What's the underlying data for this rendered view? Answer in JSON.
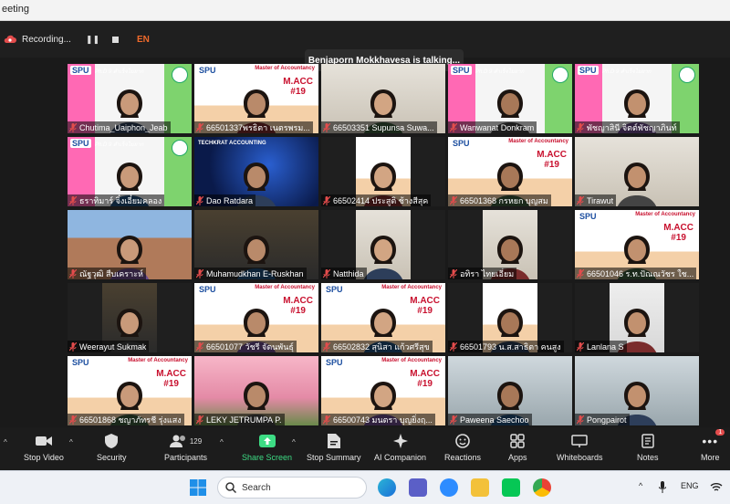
{
  "window": {
    "title": "eeting"
  },
  "recording": {
    "label": "Recording...",
    "pause_icon": "pause-icon",
    "stop_icon": "stop-icon",
    "language": "EN"
  },
  "talking_banner": "Benjaporn Mokkhavesa is talking...",
  "colors": {
    "accent_green": "#3ddc84",
    "mute_red": "#e34c4c",
    "toolbar_bg": "#1c1c1c",
    "recording_orange": "#f06a2b"
  },
  "participants": [
    {
      "name": "Chutima_Uaiphon_Jeab",
      "bg": "pink"
    },
    {
      "name": "66501337พรธิตา เนตรพรม...",
      "bg": "macc"
    },
    {
      "name": "66503351 Supunsa Suwa...",
      "bg": "room"
    },
    {
      "name": "Wanwanat Donkram",
      "bg": "pink"
    },
    {
      "name": "พัชญาสินี จิตต์พัชญาภินท์",
      "bg": "pink"
    },
    {
      "name": "ธราทิมาร์ จิ๋งเอี๋ยมคลอง",
      "bg": "pink"
    },
    {
      "name": "Dao Ratdara",
      "bg": "tech"
    },
    {
      "name": "66502414 ประสูติ ช้างสีสุค",
      "bg": "macc-small"
    },
    {
      "name": "66501368 กรหยก บุญสม",
      "bg": "macc"
    },
    {
      "name": "Tirawut",
      "bg": "room"
    },
    {
      "name": "ณัฐวุฒิ สืบเคราะห์",
      "bg": "city"
    },
    {
      "name": "Muhamudkhan E-Ruskhan",
      "bg": "dark"
    },
    {
      "name": "Natthida",
      "bg": "room-small"
    },
    {
      "name": "อทิรา ไทยเอี่ยม",
      "bg": "room-small"
    },
    {
      "name": "66501046 ร.ท.ปัณณวัชร ใช...",
      "bg": "macc"
    },
    {
      "name": "Weerayut Sukmak",
      "bg": "dark-small"
    },
    {
      "name": "66501077 วัชรี จัตนพันธุ์",
      "bg": "macc"
    },
    {
      "name": "66502832 สุนิสา แก้วศรีสุข",
      "bg": "macc"
    },
    {
      "name": "66501793 น.ส.สาธิตา คนสูง",
      "bg": "macc-small"
    },
    {
      "name": "Lanlana S",
      "bg": "light-small"
    },
    {
      "name": "66501868 ชญาภัทรชี รุ่งแสง",
      "bg": "macc"
    },
    {
      "name": "LEKY JETRUMPA P.",
      "bg": "blossom"
    },
    {
      "name": "66500743 มนตรา บุญยิ่งฤ...",
      "bg": "macc"
    },
    {
      "name": "Paweena Saechoo",
      "bg": "office"
    },
    {
      "name": "Pongpairot",
      "bg": "office"
    }
  ],
  "branding": {
    "spu": "SPU",
    "master": "Master of Accountancy",
    "macc": "M.ACC",
    "cohort": "#19",
    "phd": "Ph.D 9 สำเร็จไม่ยาก",
    "tech": "TECHKRAT ACCOUNTING"
  },
  "toolbar": {
    "stop_video": "Stop Video",
    "security": "Security",
    "participants": "Participants",
    "participants_count": "129",
    "share_screen": "Share Screen",
    "stop_summary": "Stop Summary",
    "ai_companion": "AI Companion",
    "reactions": "Reactions",
    "apps": "Apps",
    "whiteboards": "Whiteboards",
    "notes": "Notes",
    "more": "More",
    "more_badge": "1"
  },
  "taskbar": {
    "search_placeholder": "Search",
    "language": "ENG"
  }
}
